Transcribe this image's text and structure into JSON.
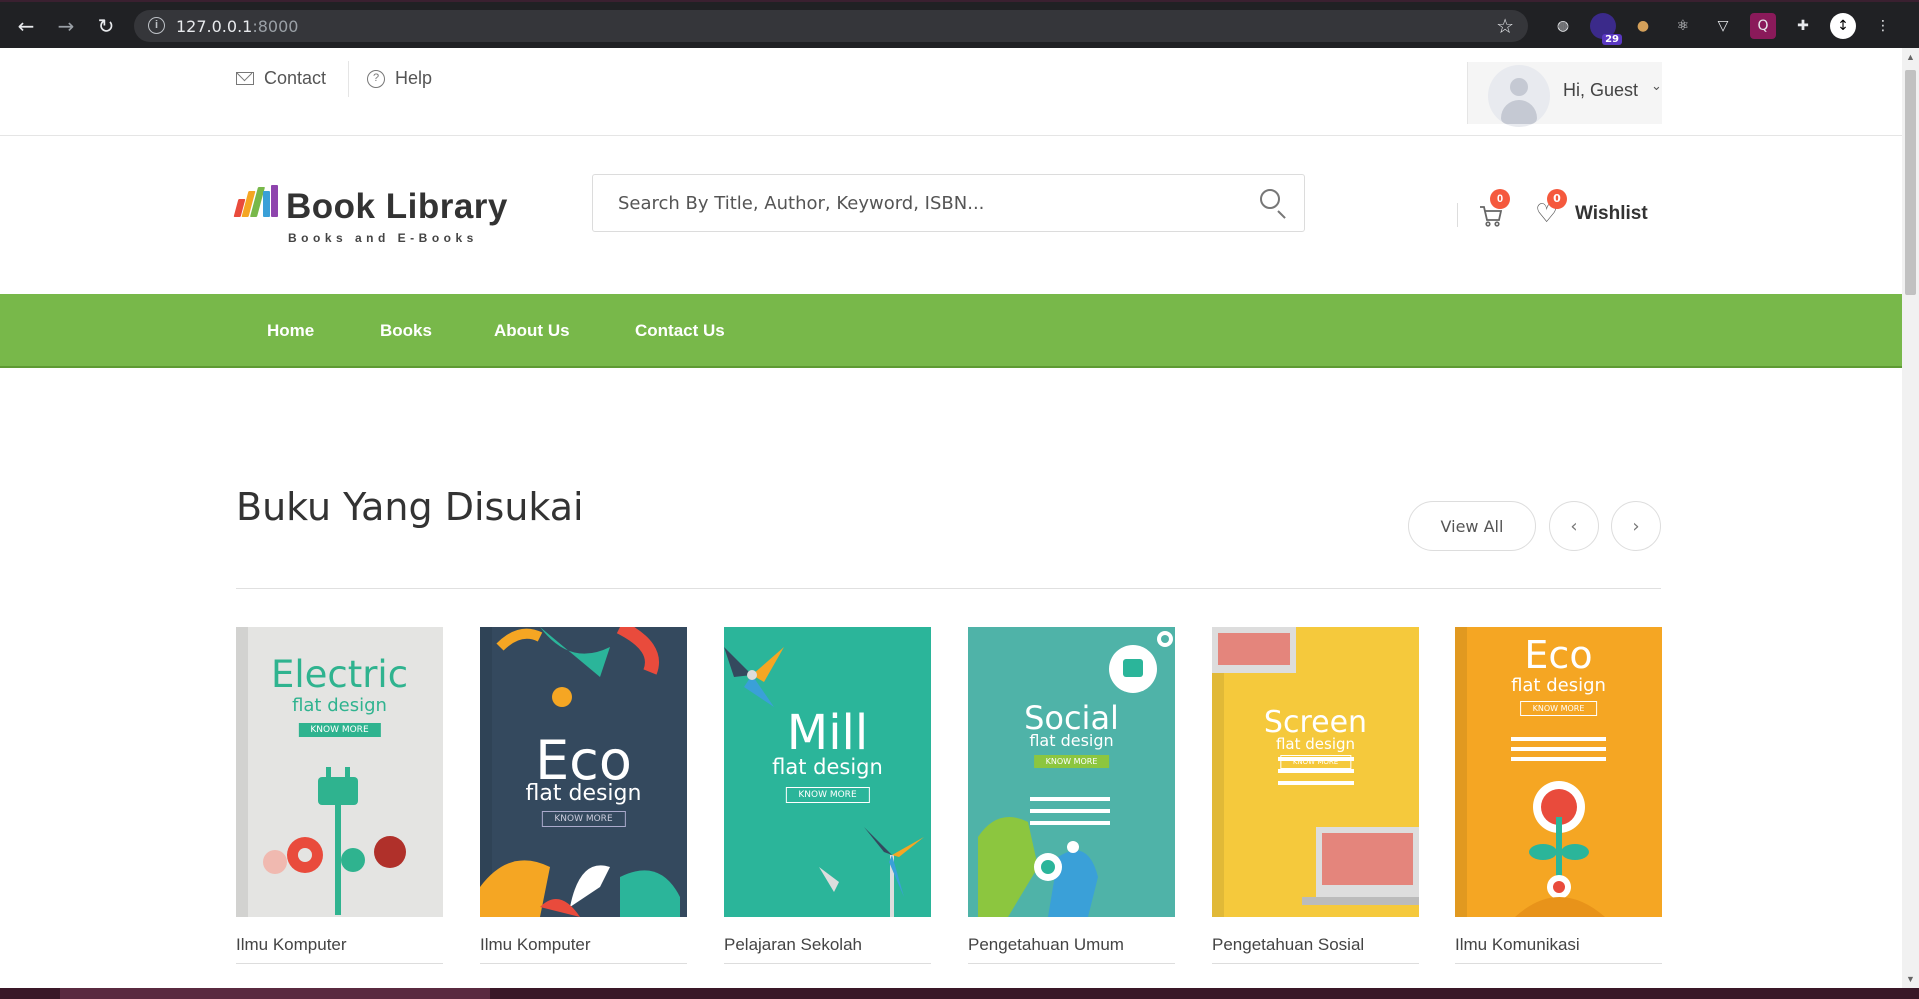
{
  "browser": {
    "url_host": "127.0.0.1",
    "url_port": ":8000",
    "extension_badge": "29"
  },
  "topbar": {
    "contact_label": "Contact",
    "help_label": "Help",
    "user_greeting": "Hi, Guest"
  },
  "header": {
    "logo_title": "Book Library",
    "logo_subtitle": "Books and E-Books",
    "search_placeholder": "Search By Title, Author, Keyword, ISBN...",
    "cart_count": "0",
    "wishlist_count": "0",
    "wishlist_label": "Wishlist"
  },
  "nav": {
    "items": [
      "Home",
      "Books",
      "About Us",
      "Contact Us"
    ]
  },
  "section": {
    "title": "Buku Yang Disukai",
    "view_all_label": "View All"
  },
  "books": [
    {
      "cover_title": "Electric",
      "cover_sub": "flat design",
      "cover_btn": "KNOW MORE",
      "category": "Ilmu Komputer",
      "bg": "#e4e4e2",
      "fg": "#2fb38f"
    },
    {
      "cover_title": "Eco",
      "cover_sub": "flat design",
      "cover_btn": "KNOW MORE",
      "category": "Ilmu Komputer",
      "bg": "#34495e",
      "fg": "#ffffff"
    },
    {
      "cover_title": "Mill",
      "cover_sub": "flat design",
      "cover_btn": "KNOW MORE",
      "category": "Pelajaran Sekolah",
      "bg": "#2bb59a",
      "fg": "#ffffff"
    },
    {
      "cover_title": "Social",
      "cover_sub": "flat design",
      "cover_btn": "KNOW MORE",
      "category": "Pengetahuan Umum",
      "bg": "#4fb3a8",
      "fg": "#ffffff"
    },
    {
      "cover_title": "Screen",
      "cover_sub": "flat design",
      "cover_btn": "KNOW MORE",
      "category": "Pengetahuan Sosial",
      "bg": "#f5c93c",
      "fg": "#ffffff"
    },
    {
      "cover_title": "Eco",
      "cover_sub": "flat design",
      "cover_btn": "KNOW MORE",
      "category": "Ilmu Komunikasi",
      "bg": "#f5a623",
      "fg": "#ffffff"
    }
  ],
  "colors": {
    "nav_green": "#78b84a",
    "badge_orange": "#f5593d"
  }
}
